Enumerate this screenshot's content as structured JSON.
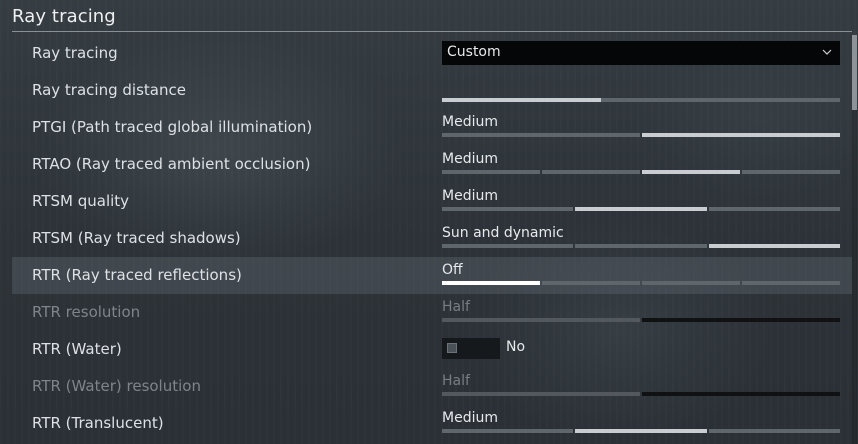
{
  "section": {
    "title": "Ray tracing"
  },
  "rows": [
    {
      "label": "Ray tracing",
      "type": "dropdown",
      "value": "Custom",
      "icon": "chevron-down-icon"
    },
    {
      "label": "Ray tracing distance",
      "type": "slider",
      "value": "",
      "fill_fraction": 0.4
    },
    {
      "label": "PTGI (Path traced global illumination)",
      "type": "select-slider",
      "value": "Medium",
      "options_count": 2,
      "selected_index": 1
    },
    {
      "label": "RTAO (Ray traced ambient occlusion)",
      "type": "select-slider",
      "value": "Medium",
      "options_count": 4,
      "selected_index": 2
    },
    {
      "label": "RTSM quality",
      "type": "select-slider",
      "value": "Medium",
      "options_count": 3,
      "selected_index": 1
    },
    {
      "label": "RTSM (Ray traced shadows)",
      "type": "select-slider",
      "value": "Sun and dynamic",
      "options_count": 3,
      "selected_index": 2
    },
    {
      "label": "RTR (Ray traced reflections)",
      "type": "select-slider",
      "value": "Off",
      "options_count": 4,
      "selected_index": 0,
      "highlighted": true
    },
    {
      "label": "RTR resolution",
      "type": "select-slider",
      "value": "Half",
      "options_count": 2,
      "selected_index": 1,
      "disabled": true
    },
    {
      "label": "RTR (Water)",
      "type": "toggle",
      "value": "No",
      "checked": false
    },
    {
      "label": "RTR (Water) resolution",
      "type": "select-slider",
      "value": "Half",
      "options_count": 2,
      "selected_index": 1,
      "disabled": true
    },
    {
      "label": "RTR (Translucent)",
      "type": "select-slider",
      "value": "Medium",
      "options_count": 3,
      "selected_index": 1
    }
  ],
  "colors": {
    "background": "#2e3439",
    "text": "#e3e6e9",
    "disabled_text": "#7e8489",
    "active_segment": "#c9cdd1",
    "inactive_segment": "#5f666c",
    "highlight_row": "#4f575e"
  }
}
